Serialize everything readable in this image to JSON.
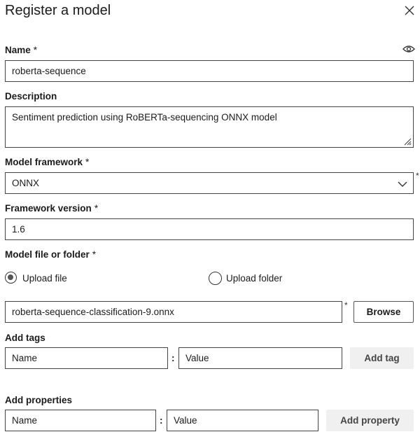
{
  "dialog": {
    "title": "Register a model"
  },
  "name": {
    "label": "Name",
    "required_mark": "*",
    "value": "roberta-sequence"
  },
  "description": {
    "label": "Description",
    "value": "Sentiment prediction using RoBERTa-sequencing ONNX model"
  },
  "framework": {
    "label": "Model framework",
    "required_mark": "*",
    "selected": "ONNX",
    "outside_mark": "*"
  },
  "framework_version": {
    "label": "Framework version",
    "required_mark": "*",
    "value": "1.6"
  },
  "model_file": {
    "label": "Model file or folder",
    "required_mark": "*",
    "options": [
      "Upload file",
      "Upload folder"
    ],
    "selected_option": "Upload file",
    "file_value": "roberta-sequence-classification-9.onnx",
    "outside_mark": "*",
    "browse_label": "Browse"
  },
  "tags": {
    "label": "Add tags",
    "name_placeholder": "Name",
    "separator": ":",
    "value_placeholder": "Value",
    "button_label": "Add tag"
  },
  "properties": {
    "label": "Add properties",
    "name_placeholder": "Name",
    "separator": ":",
    "value_placeholder": "Value",
    "button_label": "Add property"
  },
  "icons": [
    "close-icon",
    "eye-icon",
    "chevron-down-icon",
    "resize-handle-icon"
  ]
}
